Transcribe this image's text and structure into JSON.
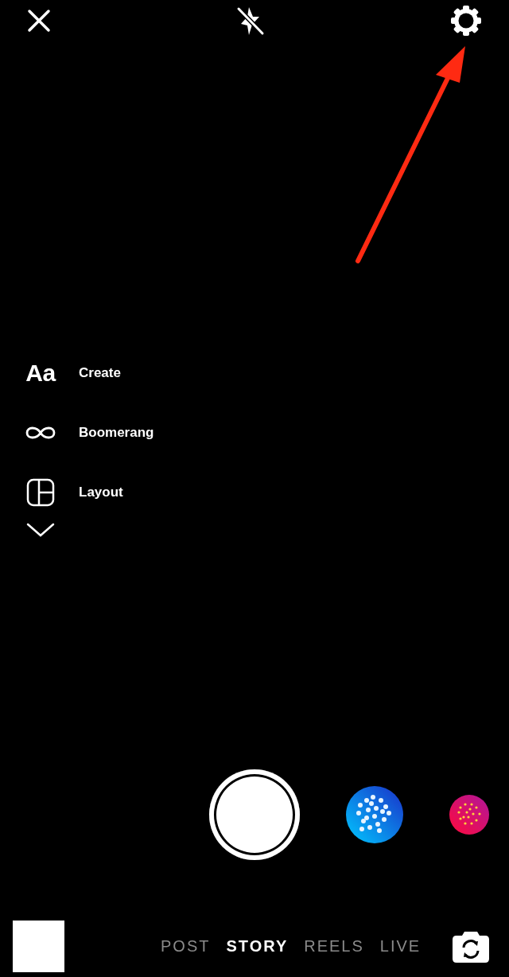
{
  "side_menu": {
    "items": [
      {
        "kind": "text",
        "icon_text": "Aa",
        "label": "Create"
      },
      {
        "kind": "boomerang",
        "label": "Boomerang"
      },
      {
        "kind": "layout",
        "label": "Layout"
      }
    ]
  },
  "modes": [
    {
      "label": "POST",
      "selected": false
    },
    {
      "label": "STORY",
      "selected": true
    },
    {
      "label": "REELS",
      "selected": false
    },
    {
      "label": "LIVE",
      "selected": false
    }
  ]
}
